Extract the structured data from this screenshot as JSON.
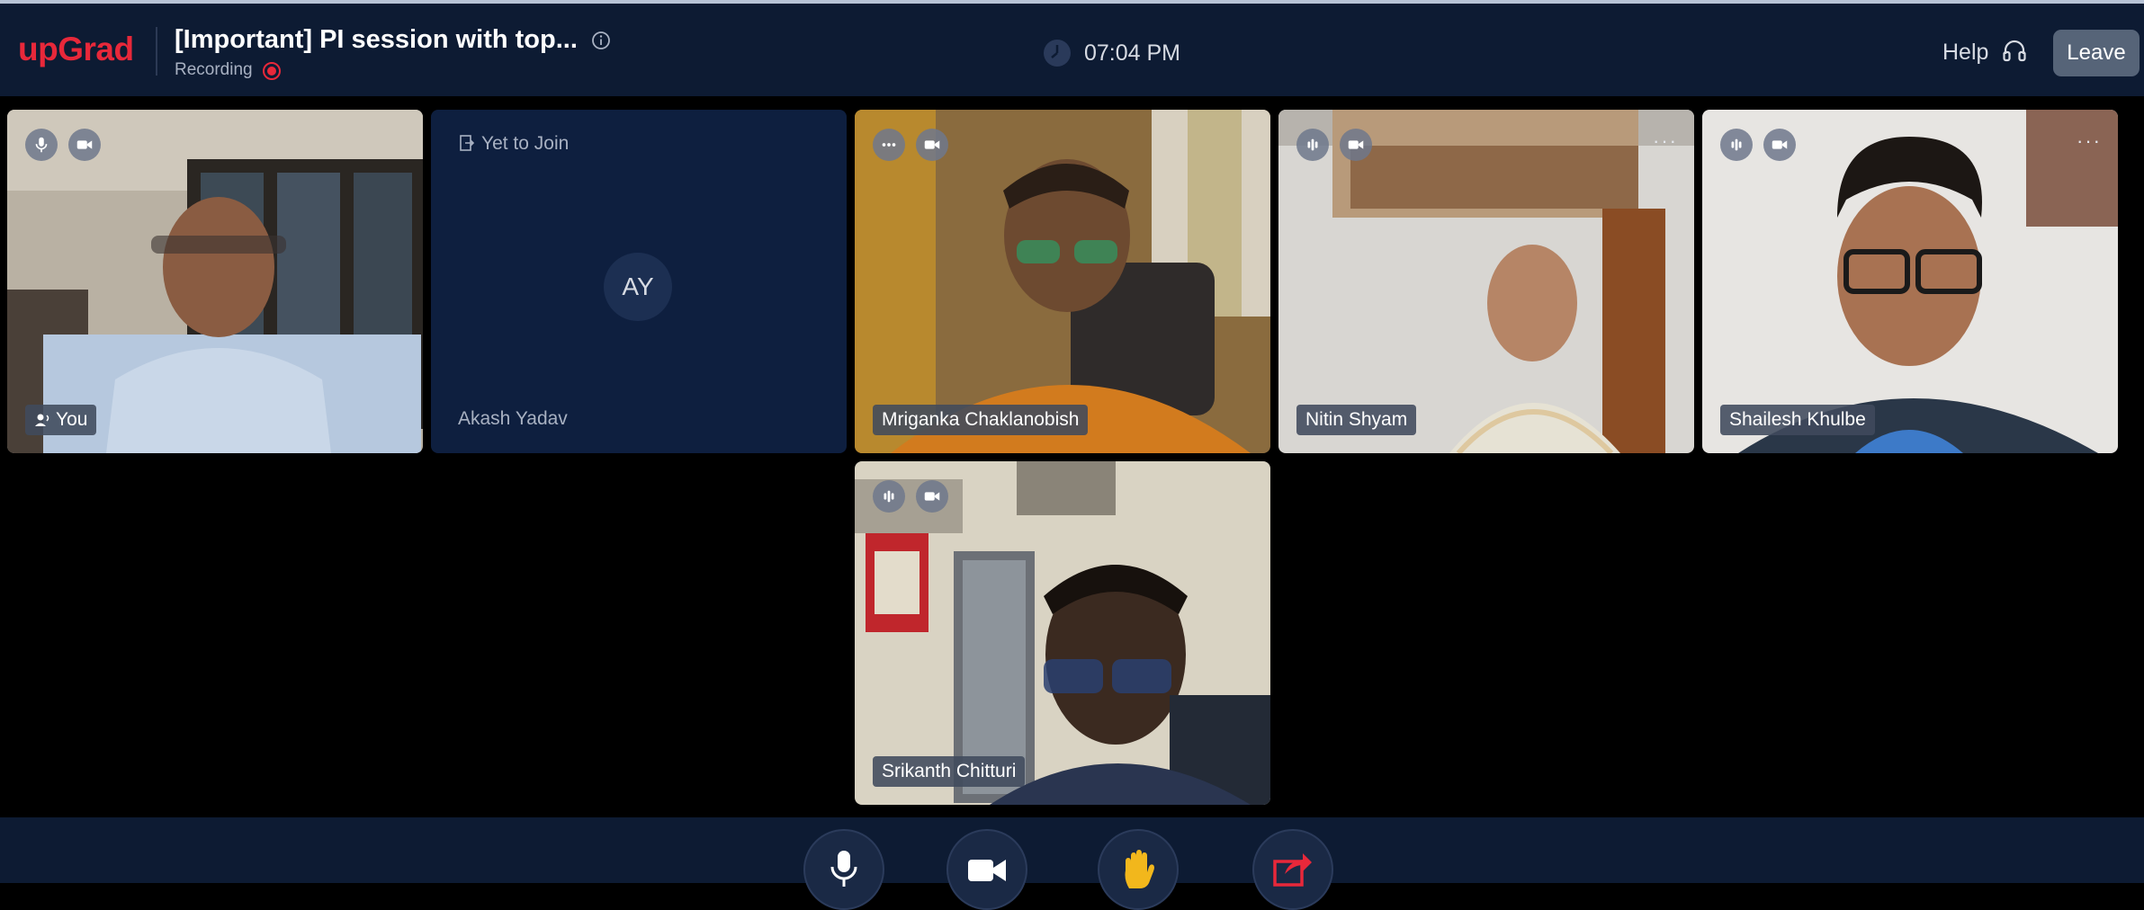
{
  "header": {
    "logo": "upGrad",
    "title": "[Important] PI session with top...",
    "recording_label": "Recording",
    "time": "07:04 PM",
    "help_label": "Help",
    "leave_label": "Leave"
  },
  "colors": {
    "brand": "#e8283a",
    "header_bg": "#0d1b33",
    "tile_empty_bg": "#0e1f3f",
    "recording_dot": "#e8283a"
  },
  "participants": [
    {
      "name": "You",
      "icons": [
        "mic-icon",
        "video-camera-icon"
      ],
      "speaking": true
    },
    {
      "name": "Akash Yadav",
      "status": "Yet to Join",
      "initials": "AY"
    },
    {
      "name": "Mriganka Chaklanobish",
      "icons": [
        "more-icon",
        "video-camera-icon"
      ]
    },
    {
      "name": "Nitin Shyam",
      "icons": [
        "audio-level-icon",
        "video-camera-icon"
      ],
      "more": "···"
    },
    {
      "name": "Shailesh Khulbe",
      "icons": [
        "audio-level-icon",
        "video-camera-icon"
      ],
      "more": "···"
    },
    {
      "name": "Srikanth Chitturi",
      "icons": [
        "audio-level-icon",
        "video-camera-icon"
      ]
    }
  ],
  "controls": [
    "microphone",
    "camera",
    "raise-hand",
    "share-screen"
  ]
}
